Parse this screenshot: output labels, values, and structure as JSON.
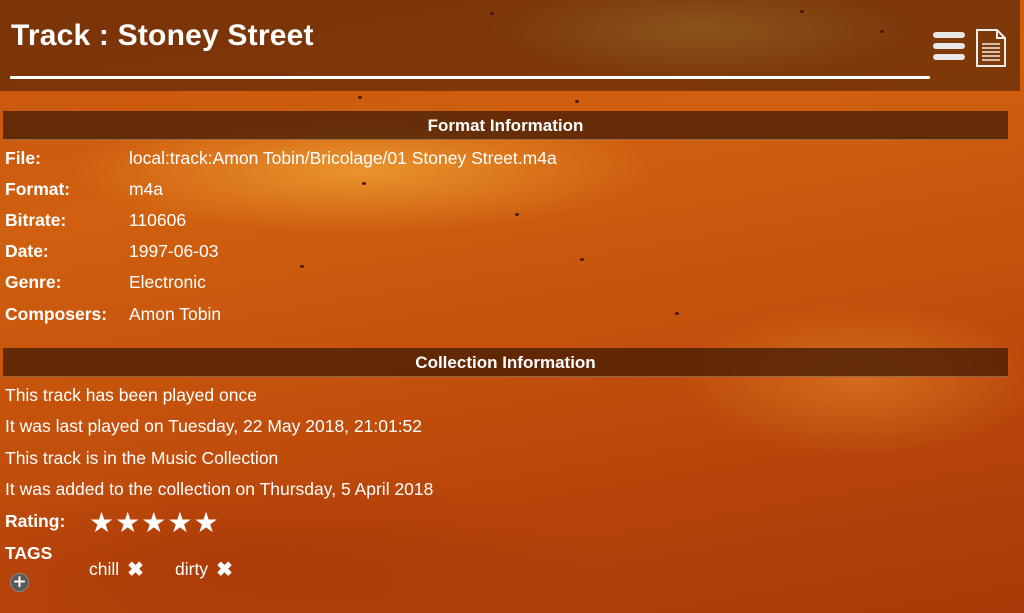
{
  "header": {
    "title": "Track : Stoney Street",
    "menu_icon": "hamburger-menu-icon",
    "doc_icon": "document-icon"
  },
  "format_info": {
    "heading": "Format Information",
    "rows": [
      {
        "label": "File:",
        "value": "local:track:Amon Tobin/Bricolage/01 Stoney Street.m4a"
      },
      {
        "label": "Format:",
        "value": "m4a"
      },
      {
        "label": "Bitrate:",
        "value": "110606"
      },
      {
        "label": "Date:",
        "value": "1997-06-03"
      },
      {
        "label": "Genre:",
        "value": "Electronic"
      },
      {
        "label": "Composers:",
        "value": "Amon Tobin"
      }
    ]
  },
  "collection_info": {
    "heading": "Collection Information",
    "lines": [
      "This track has been played once",
      "It was last played on Tuesday, 22 May 2018, 21:01:52",
      "This track is in the Music Collection",
      "It was added to the collection on Thursday, 5 April 2018"
    ],
    "rating_label": "Rating:",
    "rating": 5,
    "rating_max": 5,
    "star_glyph": "★",
    "tags_label": "TAGS",
    "tags": [
      {
        "name": "chill",
        "remove_glyph": "✖"
      },
      {
        "name": "dirty",
        "remove_glyph": "✖"
      }
    ],
    "add_tag_glyph": "+"
  },
  "colors": {
    "background": "#c4510c",
    "panel": "#46200a"
  }
}
